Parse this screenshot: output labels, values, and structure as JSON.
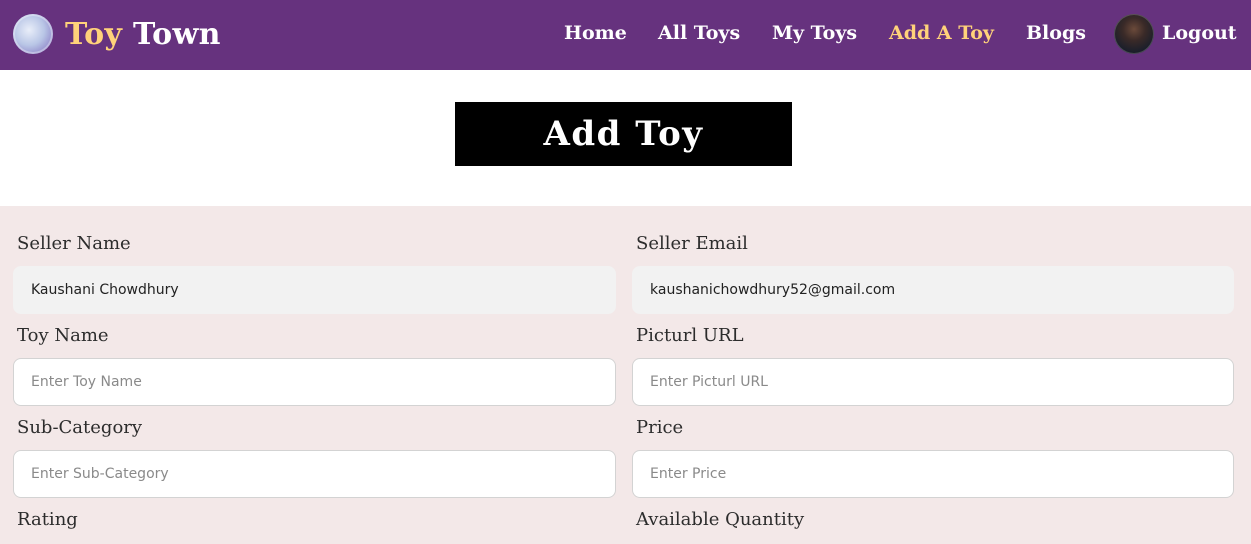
{
  "brand": {
    "part1": "Toy",
    "part2": "Town"
  },
  "nav": {
    "items": [
      {
        "label": "Home"
      },
      {
        "label": "All Toys"
      },
      {
        "label": "My Toys"
      },
      {
        "label": "Add A Toy"
      },
      {
        "label": "Blogs"
      }
    ],
    "logout": "Logout"
  },
  "page": {
    "title": "Add Toy"
  },
  "form": {
    "seller_name": {
      "label": "Seller Name",
      "value": "Kaushani Chowdhury"
    },
    "seller_email": {
      "label": "Seller Email",
      "value": "kaushanichowdhury52@gmail.com"
    },
    "toy_name": {
      "label": "Toy Name",
      "placeholder": "Enter Toy Name"
    },
    "picture_url": {
      "label": "Picturl URL",
      "placeholder": "Enter Picturl URL"
    },
    "sub_category": {
      "label": "Sub-Category",
      "placeholder": "Enter Sub-Category"
    },
    "price": {
      "label": "Price",
      "placeholder": "Enter Price"
    },
    "rating": {
      "label": "Rating"
    },
    "available_quantity": {
      "label": "Available Quantity"
    }
  },
  "colors": {
    "navbar": "#66327e",
    "accent": "#ffd27a",
    "form_bg": "#f3e8e8",
    "title_bg": "#000000"
  }
}
